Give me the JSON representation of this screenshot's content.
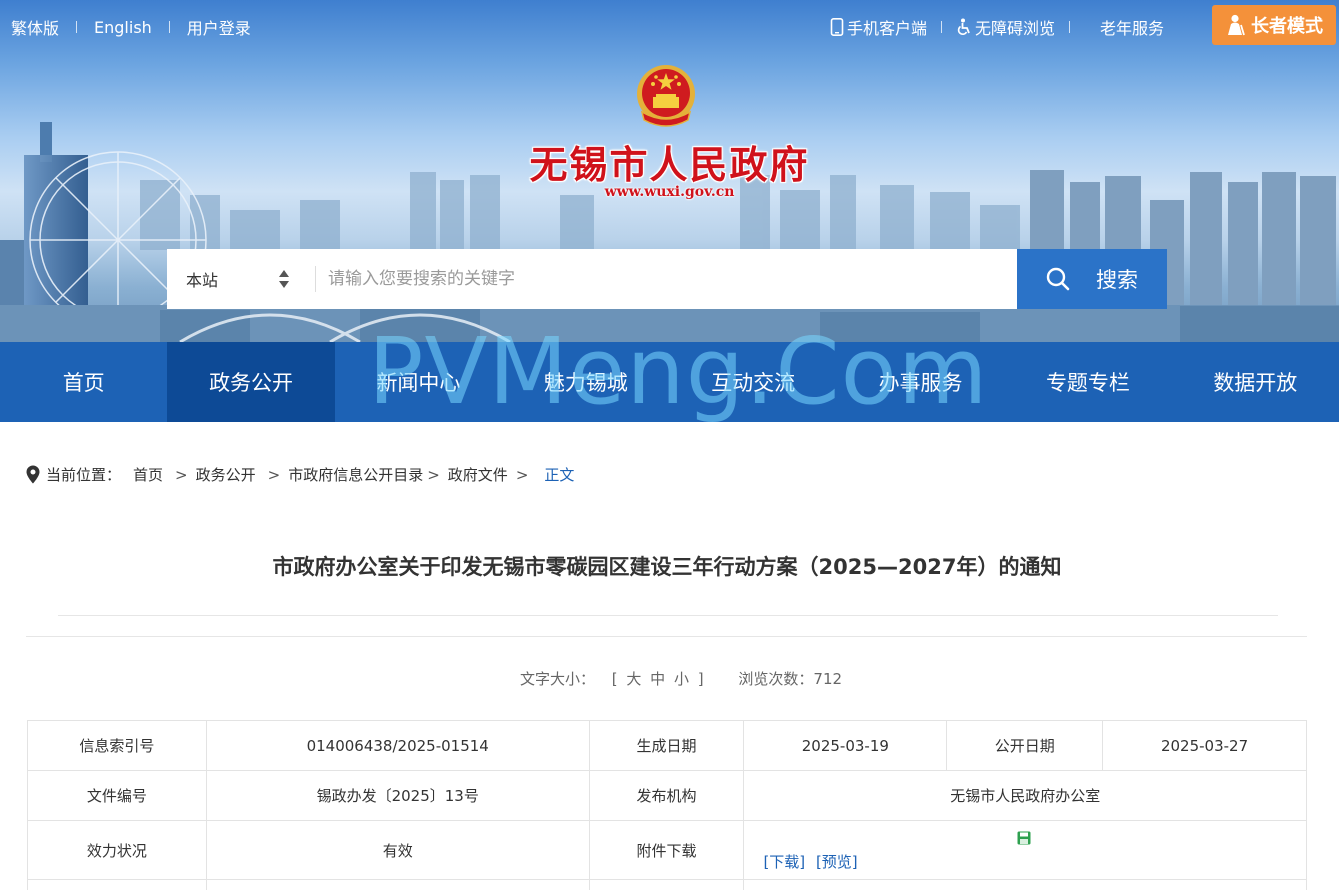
{
  "topbar": {
    "traditional": "繁体版",
    "english": "English",
    "login": "用户登录",
    "mobile": "手机客户端",
    "accessible": "无障碍浏览",
    "elderly_service": "老年服务",
    "elder_mode": "长者模式"
  },
  "site": {
    "title": "无锡市人民政府",
    "url": "www.wuxi.gov.cn"
  },
  "search": {
    "scope": "本站",
    "placeholder": "请输入您要搜索的关键字",
    "button": "搜索"
  },
  "nav": [
    {
      "label": "首页"
    },
    {
      "label": "政务公开"
    },
    {
      "label": "新闻中心"
    },
    {
      "label": "魅力锡城"
    },
    {
      "label": "互动交流"
    },
    {
      "label": "办事服务"
    },
    {
      "label": "专题专栏"
    },
    {
      "label": "数据开放"
    }
  ],
  "watermark": "PVMeng.Com",
  "breadcrumb": {
    "prefix": "当前位置：",
    "items": [
      "首页",
      "政务公开",
      "市政府信息公开目录",
      "政府文件",
      "正文"
    ]
  },
  "article": {
    "title": "市政府办公室关于印发无锡市零碳园区建设三年行动方案（2025—2027年）的通知",
    "font_size_label": "文字大小：",
    "font_size_open": "[",
    "font_large": "大",
    "font_medium": "中",
    "font_small": "小",
    "font_size_close": "]",
    "views_label": "浏览次数：",
    "views": "712"
  },
  "info_table": {
    "index_label": "信息索引号",
    "index_value": "014006438/2025-01514",
    "gen_date_label": "生成日期",
    "gen_date_value": "2025-03-19",
    "pub_date_label": "公开日期",
    "pub_date_value": "2025-03-27",
    "doc_no_label": "文件编号",
    "doc_no_value": "锡政办发〔2025〕13号",
    "issuer_label": "发布机构",
    "issuer_value": "无锡市人民政府办公室",
    "status_label": "效力状况",
    "status_value": "有效",
    "attach_label": "附件下载",
    "download": "[下载]",
    "preview": "[预览]"
  },
  "colors": {
    "nav_bg": "#1d62b5",
    "nav_active": "#0d4a96",
    "elder_btn": "#f4913a",
    "title_red": "#d0121b",
    "link_blue": "#1d62b5"
  }
}
